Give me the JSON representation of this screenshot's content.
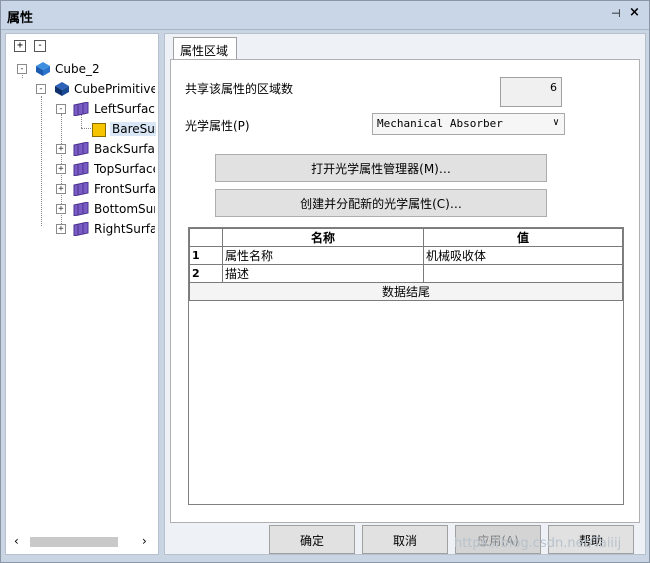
{
  "window": {
    "title": "属性",
    "pin_glyph": "⊣",
    "close_glyph": "×"
  },
  "tree": {
    "expand_all": "+",
    "collapse_all": "-",
    "nodes": [
      {
        "label": "Cube_2"
      },
      {
        "label": "CubePrimitive"
      },
      {
        "label": "LeftSurface"
      },
      {
        "label": "BareSurf"
      },
      {
        "label": "BackSurface"
      },
      {
        "label": "TopSurface"
      },
      {
        "label": "FrontSurface"
      },
      {
        "label": "BottomSurface"
      },
      {
        "label": "RightSurface"
      }
    ]
  },
  "tab": {
    "label": "属性区域"
  },
  "form": {
    "shared_label": "共享该属性的区域数",
    "shared_value": "6",
    "optical_label": "光学属性(P)",
    "optical_value": "Mechanical Absorber",
    "open_manager": "打开光学属性管理器(M)…",
    "create_assign": "创建并分配新的光学属性(C)…"
  },
  "grid": {
    "col_name": "名称",
    "col_value": "值",
    "rows": [
      {
        "num": "1",
        "name": "属性名称",
        "value": "机械吸收体"
      },
      {
        "num": "2",
        "name": "描述",
        "value": ""
      }
    ],
    "footer": "数据结尾"
  },
  "buttons": {
    "ok": "确定",
    "cancel": "取消",
    "apply": "应用(A)",
    "help": "帮助"
  },
  "watermark": "https://blog.csdn.net/Taiiij"
}
